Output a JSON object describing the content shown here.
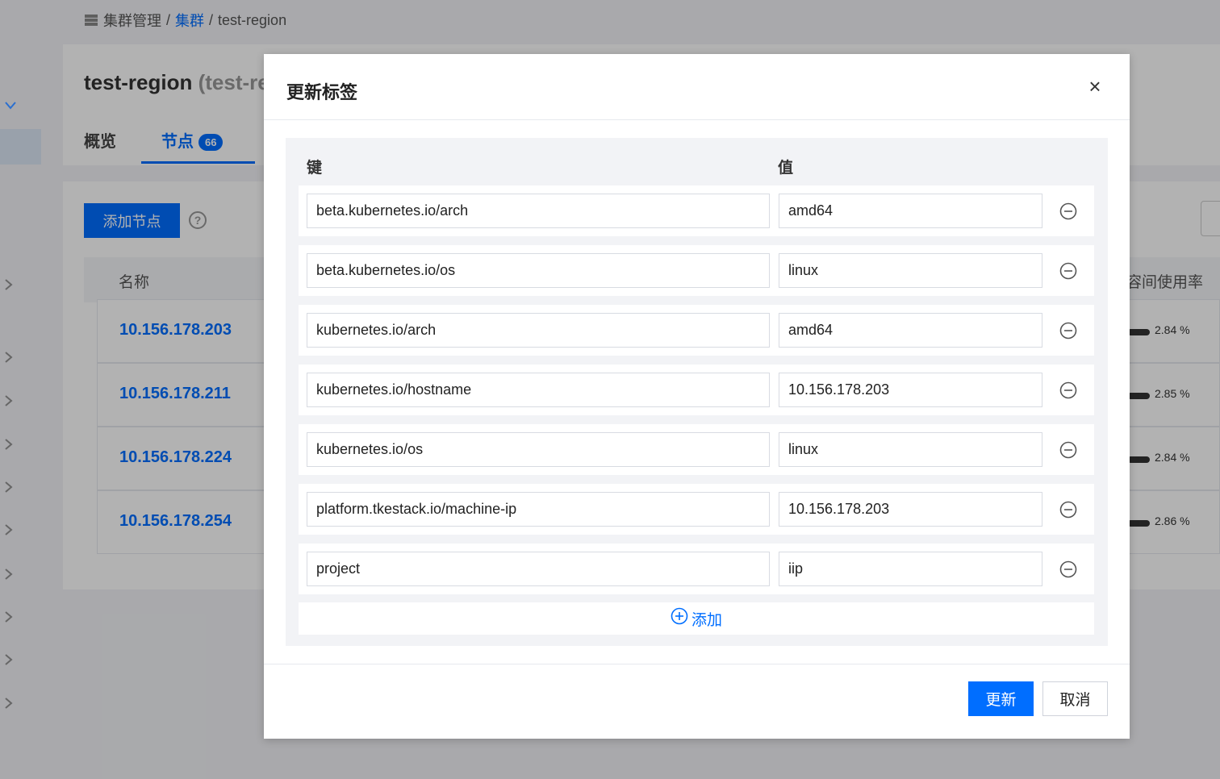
{
  "breadcrumb": {
    "root": "集群管理",
    "link": "集群",
    "current": "test-region",
    "sep": "/"
  },
  "header": {
    "title": "test-region",
    "subtitle": "(test-re",
    "tabs": [
      {
        "label": "概览"
      },
      {
        "label": "节点",
        "badge": "66"
      }
    ]
  },
  "toolbar": {
    "add_node_label": "添加节点",
    "help_icon": "question-circle-icon"
  },
  "table": {
    "col_name": "名称",
    "col_usage": "容间使用率",
    "rows": [
      {
        "ip": "10.156.178.203",
        "usage": "2.84 %"
      },
      {
        "ip": "10.156.178.211",
        "usage": "2.85 %"
      },
      {
        "ip": "10.156.178.224",
        "usage": "2.84 %"
      },
      {
        "ip": "10.156.178.254",
        "usage": "2.86 %"
      }
    ]
  },
  "modal": {
    "title": "更新标签",
    "col_key": "键",
    "col_value": "值",
    "labels": [
      {
        "key": "beta.kubernetes.io/arch",
        "value": "amd64"
      },
      {
        "key": "beta.kubernetes.io/os",
        "value": "linux"
      },
      {
        "key": "kubernetes.io/arch",
        "value": "amd64"
      },
      {
        "key": "kubernetes.io/hostname",
        "value": "10.156.178.203"
      },
      {
        "key": "kubernetes.io/os",
        "value": "linux"
      },
      {
        "key": "platform.tkestack.io/machine-ip",
        "value": "10.156.178.203"
      },
      {
        "key": "project",
        "value": "iip"
      }
    ],
    "add_label": "添加",
    "update_label": "更新",
    "cancel_label": "取消",
    "accent_color": "#006eff"
  }
}
